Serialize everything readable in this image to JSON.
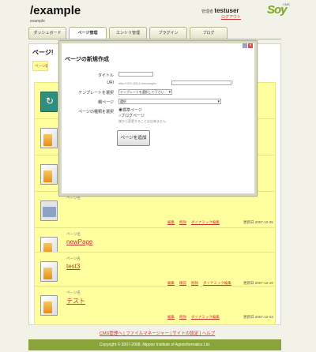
{
  "site": {
    "title": "/example",
    "subtitle": "example",
    "user_prefix": "管理者",
    "user": "testuser",
    "logout": "ログアウト",
    "logo": "Soy",
    "logo_sub": "CMS"
  },
  "tabs": [
    "ダッシュボード",
    "ページ管理",
    "エントリ管理",
    "ブラグイン",
    "ブログ"
  ],
  "main": {
    "title": "ページ!",
    "bar_link": "ページ新規"
  },
  "cards": [
    {
      "caption": "",
      "name": "",
      "actions": [],
      "date": "-01-17"
    },
    {
      "caption": "",
      "name": "",
      "actions": [],
      "date": "-12-18"
    },
    {
      "caption": "",
      "name": "",
      "actions": [],
      "date": "-12-04"
    },
    {
      "caption": "ページ名",
      "name": "",
      "actions": [
        "編集",
        "削除",
        "ダイナミック編集"
      ],
      "date": "更新日 2007-12-25"
    },
    {
      "caption": "ページ名",
      "name": "newPage",
      "actions": [
        "編集",
        "削除",
        "ダイナミック編集"
      ],
      "date": "更新日 2007-12-25"
    },
    {
      "caption": "ページ名",
      "name": "test3",
      "actions": [
        "編集",
        "確認",
        "削除",
        "ダイナミック編集"
      ],
      "date": "更新日 2007-12-19"
    },
    {
      "caption": "ページ名",
      "name": "テスト",
      "actions": [
        "編集",
        "削除",
        "ダイナミック編集"
      ],
      "date": "更新日 2007-12-23"
    }
  ],
  "footer": {
    "links": "CMS管理へ | ファイルマネージャー | サイトの設定 | ヘルプ",
    "copyright": "Copyright © 2007-2008, Nippon Institute of Agroinformatics Ltd."
  },
  "dialog": {
    "title": "ページの新規作成",
    "title_label": "タイトル",
    "title_value": "",
    "uri_label": "URI",
    "uri_prefix": "http://192.168.0.4/example/",
    "uri_suffix": "/",
    "template_label": "テンプレートを選択",
    "template_value": "テンプレートを選択して下さい",
    "parent_label": "親ページ",
    "parent_value": "選択",
    "type_label": "ページの種類を選択",
    "type_standard": "標準ページ",
    "type_blog": "ブログページ",
    "type_note": "後から変更することは出来ません",
    "add_button": "ページを追加",
    "controls": [
      "minimize",
      "close"
    ]
  }
}
